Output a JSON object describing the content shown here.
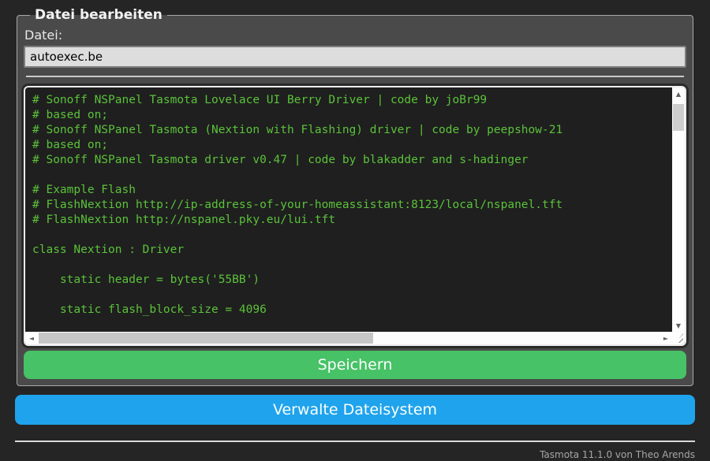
{
  "colors": {
    "page_bg": "#252525",
    "form_bg": "#4a4a4a",
    "text": "#eaeaea",
    "input_bg": "#dddddd",
    "input_text": "#000000",
    "console_bg": "#1f1f1f",
    "console_text": "#5bc23a",
    "save_button_bg": "#47c266",
    "button_bg": "#1fa3ec",
    "button_text": "#faffff",
    "footer_text": "#a6a6a6"
  },
  "editor": {
    "legend": "Datei bearbeiten",
    "file_label": "Datei:",
    "file_name": "autoexec.be",
    "save_label": "Speichern",
    "code_lines": [
      "# Sonoff NSPanel Tasmota Lovelace UI Berry Driver | code by joBr99",
      "# based on;",
      "# Sonoff NSPanel Tasmota (Nextion with Flashing) driver | code by peepshow-21",
      "# based on;",
      "# Sonoff NSPanel Tasmota driver v0.47 | code by blakadder and s-hadinger",
      "",
      "# Example Flash",
      "# FlashNextion http://ip-address-of-your-homeassistant:8123/local/nspanel.tft",
      "# FlashNextion http://nspanel.pky.eu/lui.tft",
      "",
      "class Nextion : Driver",
      "",
      "    static header = bytes('55BB')",
      "",
      "    static flash_block_size = 4096"
    ]
  },
  "filesystem": {
    "manage_label": "Verwalte Dateisystem"
  },
  "footer": {
    "version_text": "Tasmota 11.1.0 von Theo Arends"
  },
  "icons": {
    "scroll_up": "▲",
    "scroll_down": "▼",
    "scroll_left": "◄",
    "scroll_right": "►"
  }
}
